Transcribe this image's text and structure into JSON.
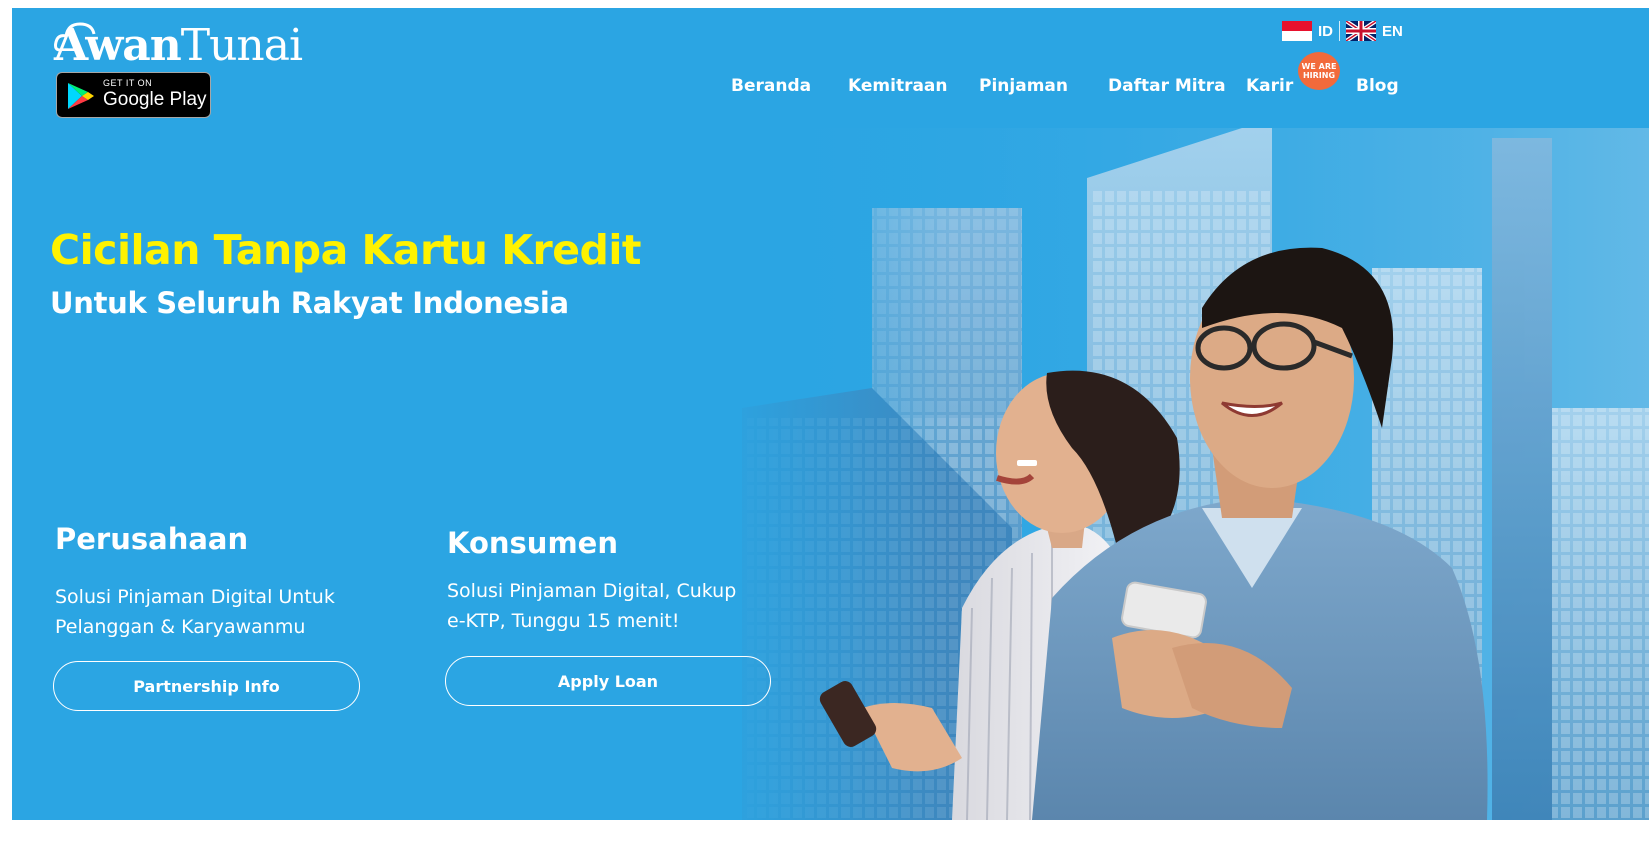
{
  "brand": {
    "logo_part1": "Awan",
    "logo_part2": "Tunai",
    "gplay_small": "GET IT ON",
    "gplay_big": "Google Play"
  },
  "language": {
    "id_label": "ID",
    "en_label": "EN"
  },
  "nav": {
    "items": [
      {
        "label": "Beranda"
      },
      {
        "label": "Kemitraan"
      },
      {
        "label": "Pinjaman"
      },
      {
        "label": "Daftar Mitra"
      },
      {
        "label": "Karir"
      },
      {
        "label": "Blog"
      }
    ],
    "hiring_badge": "WE ARE\nHIRING"
  },
  "hero": {
    "headline": "Cicilan Tanpa Kartu Kredit",
    "subheadline": "Untuk Seluruh Rakyat Indonesia"
  },
  "blocks": {
    "company": {
      "title": "Perusahaan",
      "desc": "Solusi Pinjaman Digital Untuk\nPelanggan & Karyawanmu",
      "button": "Partnership Info"
    },
    "consumer": {
      "title": "Konsumen",
      "desc": "Solusi Pinjaman Digital, Cukup\ne-KTP, Tunggu 15 menit!",
      "button": "Apply Loan"
    }
  },
  "colors": {
    "background": "#2ba5e3",
    "headline": "#fff200",
    "hiring_badge": "#f26a3b",
    "text": "#ffffff"
  }
}
